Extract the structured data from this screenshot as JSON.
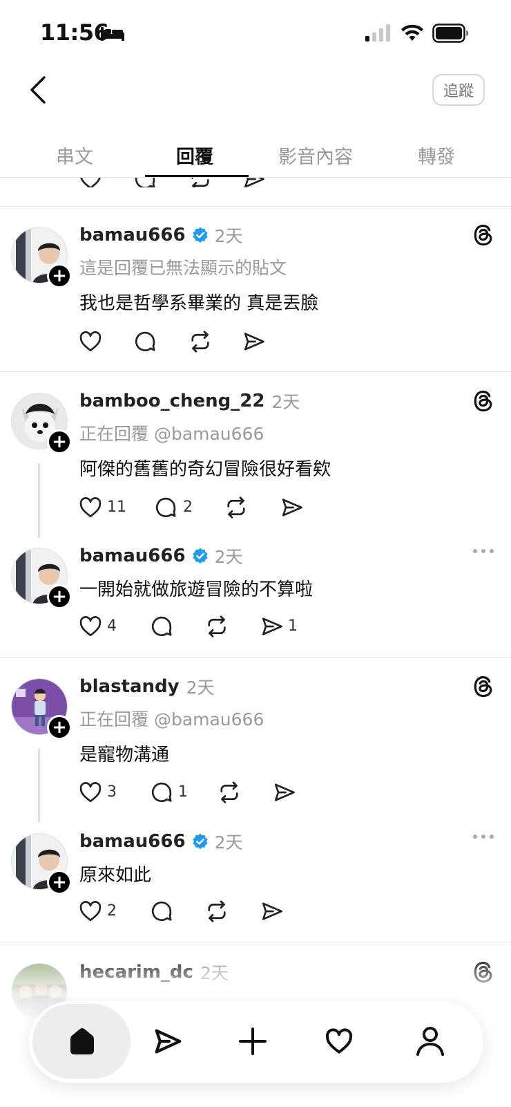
{
  "status_bar": {
    "time": "11:56"
  },
  "header": {
    "follow_label": "追蹤"
  },
  "tabs": [
    {
      "label": "串文"
    },
    {
      "label": "回覆"
    },
    {
      "label": "影音內容"
    },
    {
      "label": "轉發"
    }
  ],
  "posts": [
    {
      "username": "bamau666",
      "verified": true,
      "time": "2天",
      "context": "這是回覆已無法顯示的貼文",
      "text": "我也是哲學系畢業的 真是丟臉"
    },
    {
      "username": "bamboo_cheng_22",
      "time": "2天",
      "context": "正在回覆 @bamau666",
      "text": "阿傑的舊舊的奇幻冒險很好看欸",
      "likes": "11",
      "replies": "2",
      "reply": {
        "username": "bamau666",
        "verified": true,
        "time": "2天",
        "text": "一開始就做旅遊冒險的不算啦",
        "likes": "4",
        "shares": "1"
      }
    },
    {
      "username": "blastandy",
      "time": "2天",
      "context": "正在回覆 @bamau666",
      "text": "是寵物溝通",
      "likes": "3",
      "replies": "1",
      "reply": {
        "username": "bamau666",
        "verified": true,
        "time": "2天",
        "text": "原來如此",
        "likes": "2"
      }
    },
    {
      "username": "hecarim_dc",
      "time": "2天"
    }
  ],
  "bottom_nav": [
    "home-icon",
    "send-icon",
    "plus-icon",
    "heart-icon",
    "profile-icon"
  ],
  "colors": {
    "verified": "#1D9BF0",
    "secondary_text": "#9a9a9a",
    "divider": "#e3e3e3"
  }
}
